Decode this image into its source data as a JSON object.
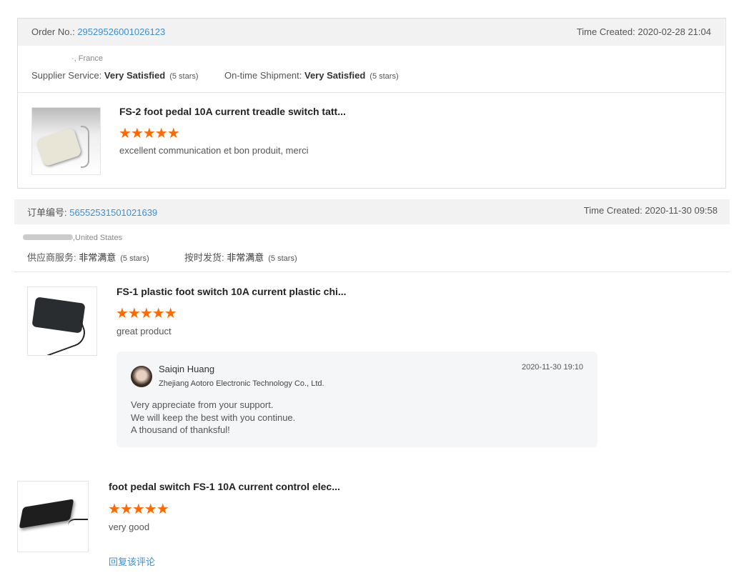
{
  "orders": [
    {
      "order_label": "Order No.:",
      "order_no": "29529526001026123",
      "time_label": "Time Created:",
      "time": "2020-02-28 21:04",
      "location": "·, France",
      "supplier_label": "Supplier Service:",
      "supplier_value": "Very Satisfied",
      "supplier_stars": "(5 stars)",
      "shipment_label": "On-time Shipment:",
      "shipment_value": "Very Satisfied",
      "shipment_stars": "(5 stars)",
      "items": [
        {
          "title": "FS-2 foot pedal 10A current treadle switch tatt...",
          "rating": 5,
          "stars": "★★★★★",
          "comment": "excellent communication et bon produit, merci"
        }
      ]
    },
    {
      "order_label": "订单编号:",
      "order_no": "56552531501021639",
      "time_label": "Time Created:",
      "time": "2020-11-30 09:58",
      "location": ",United States",
      "supplier_label": "供应商服务:",
      "supplier_value": "非常满意",
      "supplier_stars": "(5 stars)",
      "shipment_label": "按时发货:",
      "shipment_value": "非常满意",
      "shipment_stars": "(5 stars)",
      "items": [
        {
          "title": "FS-1 plastic foot switch 10A current plastic chi...",
          "rating": 5,
          "stars": "★★★★★",
          "comment": "great product",
          "reply": {
            "name": "Saiqin Huang",
            "company": "Zhejiang Aotoro Electronic Technology Co., Ltd.",
            "date": "2020-11-30 19:10",
            "lines": [
              "Very appreciate from your support.",
              "We will keep the best with you continue.",
              "A thousand of thanksful!"
            ]
          }
        },
        {
          "title": "foot pedal switch FS-1 10A current control elec...",
          "rating": 5,
          "stars": "★★★★★",
          "comment": "very good",
          "reply_link": "回复该评论"
        }
      ]
    }
  ],
  "colors": {
    "accent": "#3b8fd4",
    "star": "#ff6a00"
  }
}
